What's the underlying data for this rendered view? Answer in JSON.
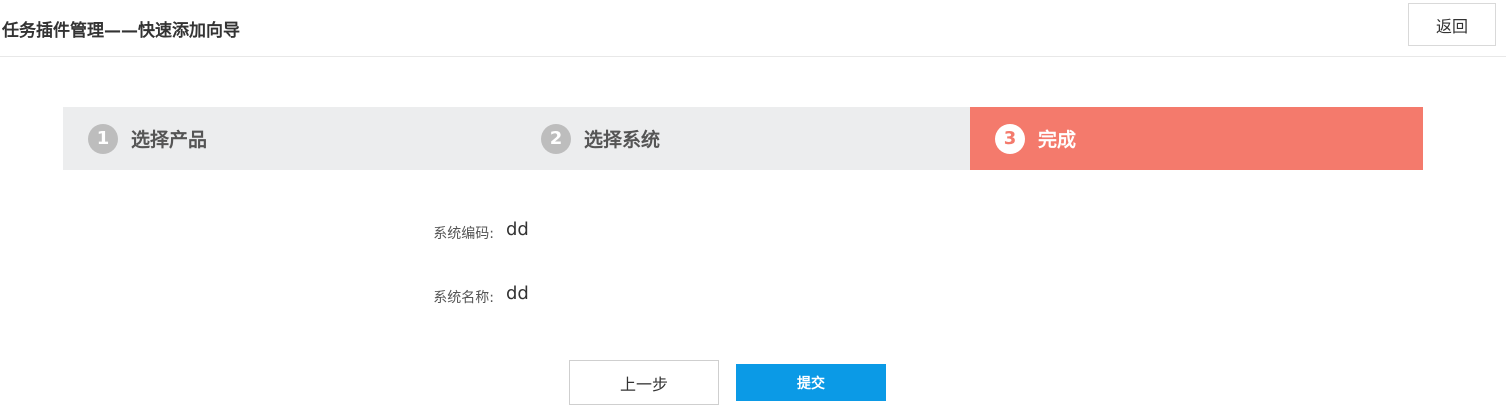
{
  "header": {
    "title": "任务插件管理——快速添加向导",
    "back_label": "返回"
  },
  "steps": [
    {
      "number": "1",
      "label": "选择产品",
      "active": false
    },
    {
      "number": "2",
      "label": "选择系统",
      "active": false
    },
    {
      "number": "3",
      "label": "完成",
      "active": true
    }
  ],
  "info": {
    "system_code_label": "系统编码:",
    "system_code_value": "dd",
    "system_name_label": "系统名称:",
    "system_name_value": "dd"
  },
  "actions": {
    "prev_label": "上一步",
    "submit_label": "提交"
  },
  "colors": {
    "active_step": "#f47a6c",
    "inactive_step": "#ecedee",
    "submit": "#0b9ae6"
  }
}
